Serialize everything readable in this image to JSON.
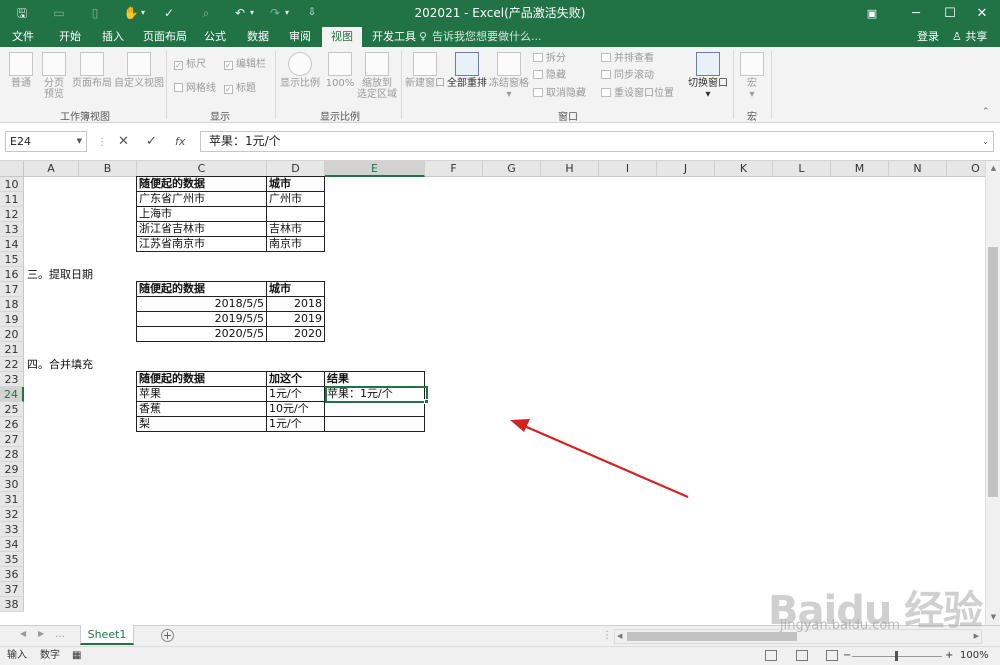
{
  "window": {
    "title": "202021 - Excel(产品激活失败)",
    "restore_icon": "ribbon-display-icon",
    "minimize": "─",
    "maximize": "☐",
    "close": "✕"
  },
  "quick_access": {
    "save_glyph": "🖫",
    "touch_glyph": "✋",
    "undo_glyph": "↶",
    "redo_glyph": "↷",
    "customize_glyph": "⇩"
  },
  "ribbon_tabs": [
    "文件",
    "开始",
    "插入",
    "页面布局",
    "公式",
    "数据",
    "审阅",
    "视图",
    "开发工具"
  ],
  "active_tab": "视图",
  "tell_me": "告诉我您想要做什么...",
  "login": "登录",
  "share": "共享",
  "ribbon": {
    "workbook_views": {
      "label": "工作簿视图",
      "normal": "普通",
      "page_break_line1": "分页",
      "page_break_line2": "预览",
      "page_layout": "页面布局",
      "custom_views": "自定义视图"
    },
    "show": {
      "label": "显示",
      "ruler": "标尺",
      "formula_bar": "编辑栏",
      "gridlines": "网格线",
      "headings": "标题"
    },
    "zoom": {
      "label": "显示比例",
      "zoom": "显示比例",
      "zoom_100": "100%",
      "zoom_sel_line1": "缩放到",
      "zoom_sel_line2": "选定区域"
    },
    "window": {
      "label": "窗口",
      "new_window": "新建窗口",
      "arrange_all": "全部重排",
      "freeze_panes": "冻结窗格",
      "split": "拆分",
      "hide": "隐藏",
      "unhide": "取消隐藏",
      "side_by_side": "并排查看",
      "sync_scroll": "同步滚动",
      "reset_pos": "重设窗口位置",
      "switch_windows": "切换窗口"
    },
    "macros": {
      "label": "宏",
      "macros": "宏"
    }
  },
  "formula_bar": {
    "name_box": "E24",
    "fx": "fx",
    "cancel": "✕",
    "enter": "✓",
    "content": "苹果：1元/个"
  },
  "columns": [
    "A",
    "B",
    "C",
    "D",
    "E",
    "F",
    "G",
    "H",
    "I",
    "J",
    "K",
    "L",
    "M",
    "N",
    "O"
  ],
  "selected_column": "E",
  "rows": [
    "10",
    "11",
    "12",
    "13",
    "14",
    "15",
    "16",
    "17",
    "18",
    "19",
    "20",
    "21",
    "22",
    "23",
    "24",
    "25",
    "26",
    "27",
    "28",
    "29",
    "30",
    "31",
    "32",
    "33",
    "34",
    "35",
    "36",
    "37",
    "38"
  ],
  "selected_row": "24",
  "sections": {
    "extract_date": "三。提取日期",
    "merge_fill": "四。合并填充"
  },
  "table_city": {
    "headers": [
      "随便起的数据",
      "城市"
    ],
    "rows": [
      [
        "广东省广州市",
        "广州市"
      ],
      [
        "上海市",
        ""
      ],
      [
        "浙江省吉林市",
        "吉林市"
      ],
      [
        "江苏省南京市",
        "南京市"
      ]
    ]
  },
  "table_date": {
    "headers": [
      "随便起的数据",
      "城市"
    ],
    "rows": [
      [
        "2018/5/5",
        "2018"
      ],
      [
        "2019/5/5",
        "2019"
      ],
      [
        "2020/5/5",
        "2020"
      ]
    ]
  },
  "table_merge": {
    "headers": [
      "随便起的数据",
      "加这个",
      "结果"
    ],
    "rows": [
      [
        "苹果",
        "1元/个",
        "苹果：1元/个"
      ],
      [
        "香蕉",
        "10元/个",
        ""
      ],
      [
        "梨",
        "1元/个",
        ""
      ]
    ]
  },
  "sheet_tab": "Sheet1",
  "add_sheet": "+",
  "status": {
    "mode": "输入",
    "num": "数字",
    "zoom": "100%",
    "zoom_minus": "−",
    "zoom_plus": "+"
  },
  "watermark": {
    "logo": "Baidu 经验",
    "url": "jingyan.baidu.com"
  },
  "colors": {
    "excel_green": "#217346",
    "arrow_red": "#d42121"
  }
}
